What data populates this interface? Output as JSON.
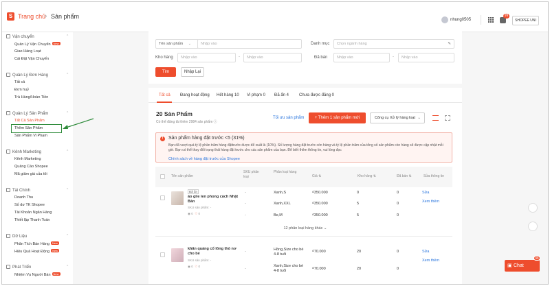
{
  "header": {
    "brand": "Trang chủ",
    "separator": "›",
    "page": "Sản phẩm",
    "username": "nhung0505",
    "notif_count": "99",
    "shop_button": "SHOPEE UNI",
    "logo_letter": "S"
  },
  "sidebar": {
    "sections": [
      {
        "title": "Vận chuyển",
        "items": [
          {
            "label": "Quản Lý Vận Chuyển",
            "badge": "New"
          },
          {
            "label": "Giao Hàng Loạt"
          },
          {
            "label": "Cài Đặt Vận Chuyển"
          }
        ]
      },
      {
        "title": "Quản Lý Đơn Hàng",
        "items": [
          {
            "label": "Tất cả"
          },
          {
            "label": "Đơn huỷ"
          },
          {
            "label": "Trả Hàng/Hoàn Tiền"
          }
        ]
      },
      {
        "title": "Quản Lý Sản Phẩm",
        "items": [
          {
            "label": "Tất Cả Sản Phẩm"
          },
          {
            "label": "Thêm Sản Phẩm"
          },
          {
            "label": "Sản Phẩm Vi Phạm"
          }
        ]
      },
      {
        "title": "Kênh Marketing",
        "items": [
          {
            "label": "Kênh Marketing"
          },
          {
            "label": "Quảng Cáo Shopee"
          },
          {
            "label": "Mã giảm giá của tôi"
          }
        ]
      },
      {
        "title": "Tài Chính",
        "items": [
          {
            "label": "Doanh Thu"
          },
          {
            "label": "Số dư TK Shopee"
          },
          {
            "label": "Tài Khoản Ngân Hàng"
          },
          {
            "label": "Thiết lập Thanh Toán"
          }
        ]
      },
      {
        "title": "Dữ Liệu",
        "items": [
          {
            "label": "Phân Tích Bán Hàng",
            "badge": "New"
          },
          {
            "label": "Hiệu Quả Hoạt Động",
            "badge": "New"
          }
        ]
      },
      {
        "title": "Phát Triển",
        "items": [
          {
            "label": "Nhiệm Vụ Người Bán",
            "badge": "New"
          }
        ]
      }
    ]
  },
  "filters": {
    "product_name_select": "Tên sản phẩm",
    "product_name_placeholder": "Nhập vào",
    "category_label": "Danh mục",
    "category_placeholder": "Chọn ngành hàng",
    "stock_label": "Kho hàng",
    "stock_min_placeholder": "Nhập vào",
    "stock_max_placeholder": "Nhập vào",
    "sold_label": "Đã bán",
    "sold_min_placeholder": "Nhập vào",
    "sold_max_placeholder": "Nhập vào",
    "range_dash": "-",
    "search_button": "Tìm",
    "reset_button": "Nhập Lại"
  },
  "tabs": [
    {
      "label": "Tất cả"
    },
    {
      "label": "Đang hoạt động"
    },
    {
      "label": "Hết hàng 10"
    },
    {
      "label": "Vi phạm 0"
    },
    {
      "label": "Đã ẩn 4"
    },
    {
      "label": "Chưa được đăng 0"
    }
  ],
  "list": {
    "count_title": "20 Sản Phẩm",
    "count_sub": "Có thể đăng tải thêm 2984 sản phẩm",
    "optimize_link": "Tối ưu sản phẩm",
    "add_button": "+ Thêm 1 sản phẩm mới",
    "tool_button": "Công cụ Xử lý hàng loạt"
  },
  "alert": {
    "icon": "!",
    "title": "Sản phẩm hàng đặt trước <5 (31%)",
    "body": "Bạn đã vượt quá tỷ lệ phần trăm hàng đặttrước được để xuất là (10%). Số lượng hàng đặt trước còn hàng và tỷ lệ phần trăm của tổng số sản phẩm còn hàng sẽ được cập nhật mỗi giờ. Bạn có thể thay đổi trạng thái hàng đặt trước cho các sản phẩm của bạn. Để biết thêm thông tin, vui lòng đọc",
    "link": "Chính sách về hàng đặt trước của Shopee"
  },
  "table": {
    "headers": [
      "Tên sản phẩm",
      "SKU phân loại",
      "Phân loại hàng",
      "Giá",
      "Kho hàng",
      "Đã bán",
      "Sửa thông tin"
    ],
    "products": [
      {
        "tag": "Đã ẩn",
        "name": "áo gile len phong cách Nhật Bản",
        "sku": "SKU sản phẩm: -",
        "views": "0",
        "likes": "0",
        "sku_variant": "-",
        "variants": [
          {
            "name": "Xanh,S",
            "price": "₫350.000",
            "stock": "0",
            "sold": "0"
          },
          {
            "name": "Xanh,XXL",
            "price": "₫350.000",
            "stock": "5",
            "sold": "0"
          },
          {
            "name": "Be,M",
            "price": "₫350.000",
            "stock": "5",
            "sold": "0"
          }
        ],
        "edit": "Sửa",
        "view_more": "Xem thêm",
        "more_variants": "12 phân loại hàng khác"
      },
      {
        "name": "khăn quàng cổ lông thỏ nơ cho bé",
        "sku": "SKU sản phẩm: -",
        "views": "0",
        "likes": "0",
        "sku_variant": "-",
        "variants": [
          {
            "name": "Hồng,Size cho bé 4-8 tuổi",
            "price": "₫70.000",
            "stock": "20",
            "sold": "0"
          },
          {
            "name": "Xanh,Size cho bé 4-8 tuổi",
            "price": "₫70.000",
            "stock": "20",
            "sold": "0"
          }
        ],
        "edit": "Sửa",
        "view_more": "Xem thêm"
      }
    ]
  },
  "chat": {
    "label": "Chat",
    "badge": "99"
  },
  "colors": {
    "accent": "#ee4d2d",
    "link": "#2673dd",
    "annotation": "#2e8b3a"
  }
}
